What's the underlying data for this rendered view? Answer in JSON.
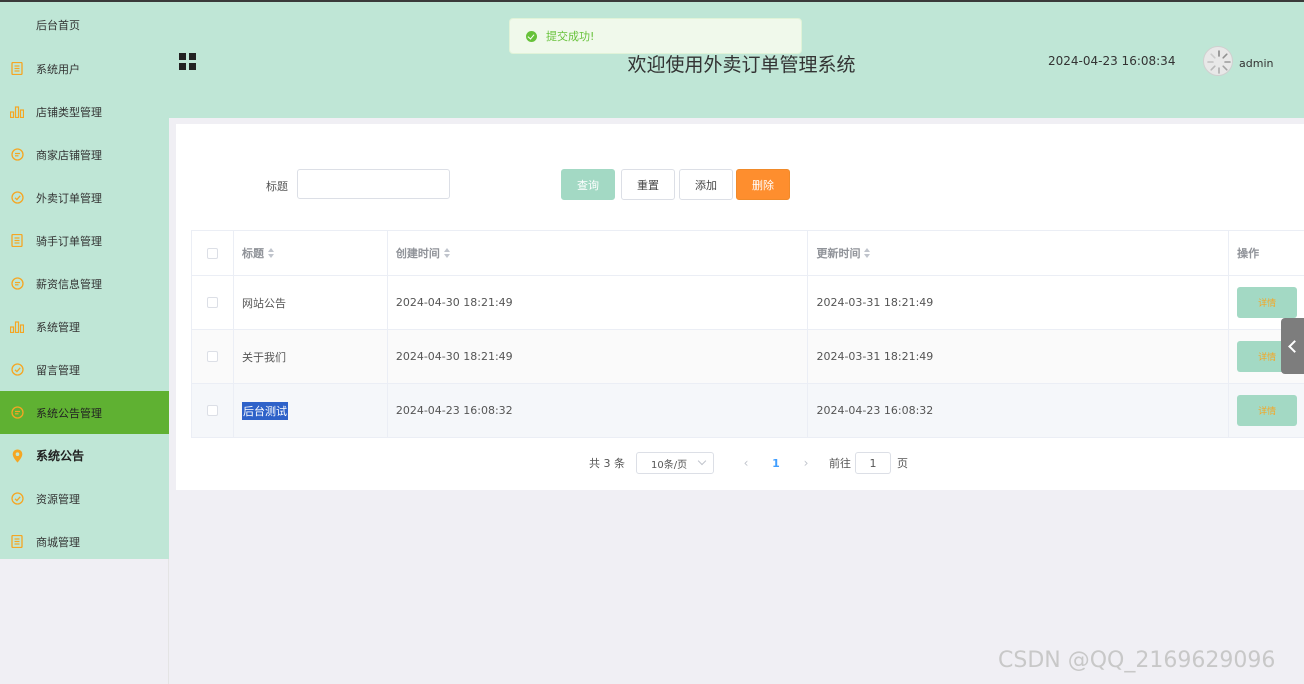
{
  "sidebar": {
    "home": "后台首页",
    "items": [
      {
        "label": "系统用户",
        "icon": "document-icon"
      },
      {
        "label": "店铺类型管理",
        "icon": "bar-chart-icon"
      },
      {
        "label": "商家店铺管理",
        "icon": "chat-bubble-icon"
      },
      {
        "label": "外卖订单管理",
        "icon": "check-circle-icon"
      },
      {
        "label": "骑手订单管理",
        "icon": "document-icon"
      },
      {
        "label": "薪资信息管理",
        "icon": "chat-bubble-icon"
      },
      {
        "label": "系统管理",
        "icon": "bar-chart-icon"
      },
      {
        "label": "留言管理",
        "icon": "check-circle-icon"
      },
      {
        "label": "系统公告管理",
        "icon": "chat-bubble-icon"
      },
      {
        "label": "系统公告",
        "icon": "location-pin-icon"
      },
      {
        "label": "资源管理",
        "icon": "check-circle-icon"
      },
      {
        "label": "商城管理",
        "icon": "document-icon"
      }
    ]
  },
  "header": {
    "title": "欢迎使用外卖订单管理系统",
    "datetime": "2024-04-23 16:08:34",
    "username": "admin"
  },
  "toast": {
    "message": "提交成功!"
  },
  "search": {
    "label": "标题",
    "value": ""
  },
  "toolbar": {
    "query": "查询",
    "reset": "重置",
    "add": "添加",
    "delete": "删除"
  },
  "table": {
    "headers": {
      "title": "标题",
      "created": "创建时间",
      "updated": "更新时间",
      "ops": "操作"
    },
    "rows": [
      {
        "title": "网站公告",
        "created": "2024-04-30 18:21:49",
        "updated": "2024-03-31 18:21:49",
        "action": "详情"
      },
      {
        "title": "关于我们",
        "created": "2024-04-30 18:21:49",
        "updated": "2024-03-31 18:21:49",
        "action": "详情"
      },
      {
        "title": "后台测试",
        "created": "2024-04-23 16:08:32",
        "updated": "2024-04-23 16:08:32",
        "action": "详情"
      }
    ]
  },
  "pagination": {
    "total": "共 3 条",
    "page_size": "10条/页",
    "current": "1",
    "goto_label": "前往",
    "goto_value": "1",
    "page_suffix": "页"
  },
  "watermark": "CSDN @QQ_2169629096",
  "colors": {
    "theme": "#bfe6d6",
    "active": "#5fb132",
    "accent_orange": "#fe8e2e",
    "success": "#67c23a"
  }
}
